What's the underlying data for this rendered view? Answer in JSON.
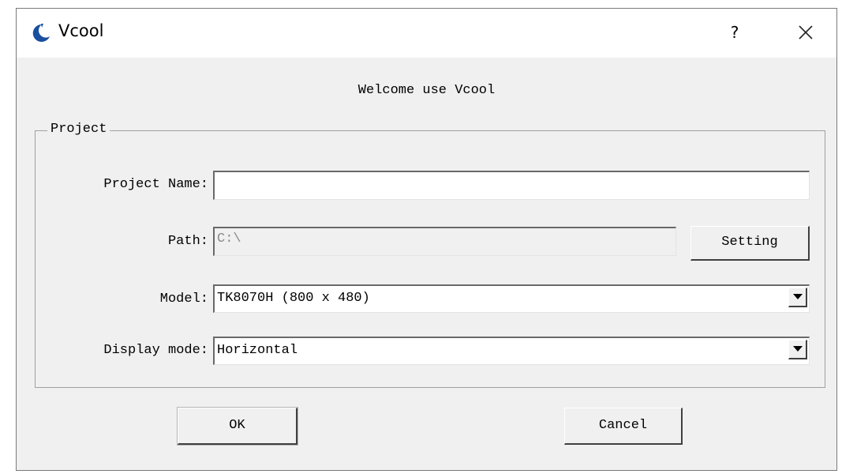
{
  "window": {
    "title": "Vcool",
    "help_label": "?",
    "close_icon": "close-icon",
    "app_icon": "vcool-logo-icon"
  },
  "welcome_text": "Welcome use Vcool",
  "project_group": {
    "legend": "Project",
    "project_name": {
      "label": "Project Name:",
      "value": ""
    },
    "path": {
      "label": "Path:",
      "value": "C:\\",
      "setting_label": "Setting"
    },
    "model": {
      "label": "Model:",
      "value": "TK8070H (800 x 480)"
    },
    "display_mode": {
      "label": "Display mode:",
      "value": "Horizontal"
    }
  },
  "buttons": {
    "ok_label": "OK",
    "cancel_label": "Cancel"
  },
  "colors": {
    "dialog_bg": "#f0f0f0",
    "titlebar_bg": "#ffffff",
    "logo_blue": "#1a4fa0"
  }
}
